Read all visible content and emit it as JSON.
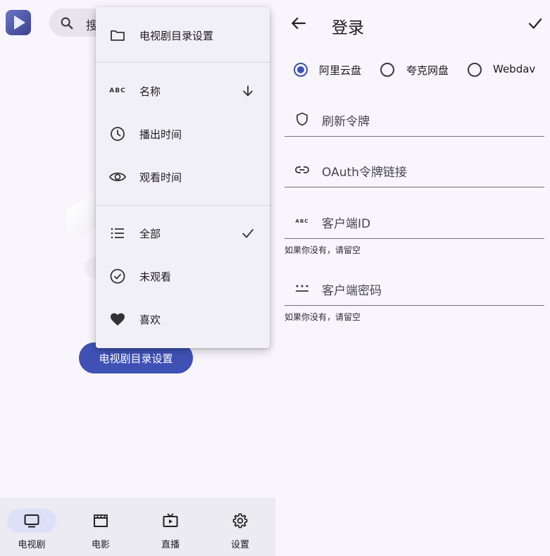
{
  "left": {
    "search_text": "搜",
    "cta_label": "电视剧目录设置",
    "menu": {
      "header_item": {
        "label": "电视剧目录设置",
        "icon": "folder-icon"
      },
      "sort_items": [
        {
          "label": "名称",
          "icon": "abc-icon",
          "abc": "ABC",
          "trailing": "arrow-down-icon"
        },
        {
          "label": "播出时间",
          "icon": "clock-icon"
        },
        {
          "label": "观看时间",
          "icon": "eye-icon"
        }
      ],
      "filter_items": [
        {
          "label": "全部",
          "icon": "list-icon",
          "trailing": "check-icon"
        },
        {
          "label": "未观看",
          "icon": "check-circle-icon"
        },
        {
          "label": "喜欢",
          "icon": "heart-icon"
        }
      ]
    },
    "bottom_nav": [
      {
        "label": "电视剧",
        "icon": "tv-icon",
        "active": true
      },
      {
        "label": "电影",
        "icon": "movie-clapper-icon"
      },
      {
        "label": "直播",
        "icon": "live-tv-icon"
      },
      {
        "label": "设置",
        "icon": "gear-icon"
      }
    ]
  },
  "right": {
    "title": "登录",
    "providers": [
      {
        "label": "阿里云盘",
        "checked": true
      },
      {
        "label": "夸克网盘",
        "checked": false
      },
      {
        "label": "Webdav",
        "checked": false
      }
    ],
    "fields": [
      {
        "placeholder": "刷新令牌",
        "icon": "shield-icon"
      },
      {
        "placeholder": "OAuth令牌链接",
        "icon": "link-icon"
      },
      {
        "placeholder": "客户端ID",
        "icon": "abc-icon",
        "abc": "ABC",
        "helper": "如果你没有，请留空"
      },
      {
        "placeholder": "客户端密码",
        "icon": "password-icon",
        "helper": "如果你没有，请留空"
      }
    ]
  },
  "colors": {
    "accent": "#3f51b5",
    "nav_active": "#dde0f8",
    "menu_bg": "#f2f0f7"
  }
}
